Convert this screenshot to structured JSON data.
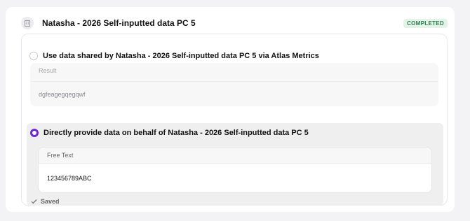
{
  "header": {
    "title": "Natasha - 2026 Self-inputted data PC 5",
    "status_badge": "COMPLETED",
    "icon": "building-icon"
  },
  "options": {
    "shared": {
      "label": "Use data shared by Natasha - 2026 Self-inputted data PC 5 via Atlas Metrics",
      "selected": false,
      "result_label": "Result",
      "result_value": "dgfeagegqegqwf"
    },
    "direct": {
      "label": "Directly provide data on behalf of Natasha - 2026 Self-inputted data PC 5",
      "selected": true,
      "field_label": "Free Text",
      "field_value": "123456789ABC",
      "saved_label": "Saved"
    }
  },
  "colors": {
    "accent": "#6b2bd9",
    "badge_text": "#2e7d4f",
    "badge_bg": "#e3f3e8"
  }
}
